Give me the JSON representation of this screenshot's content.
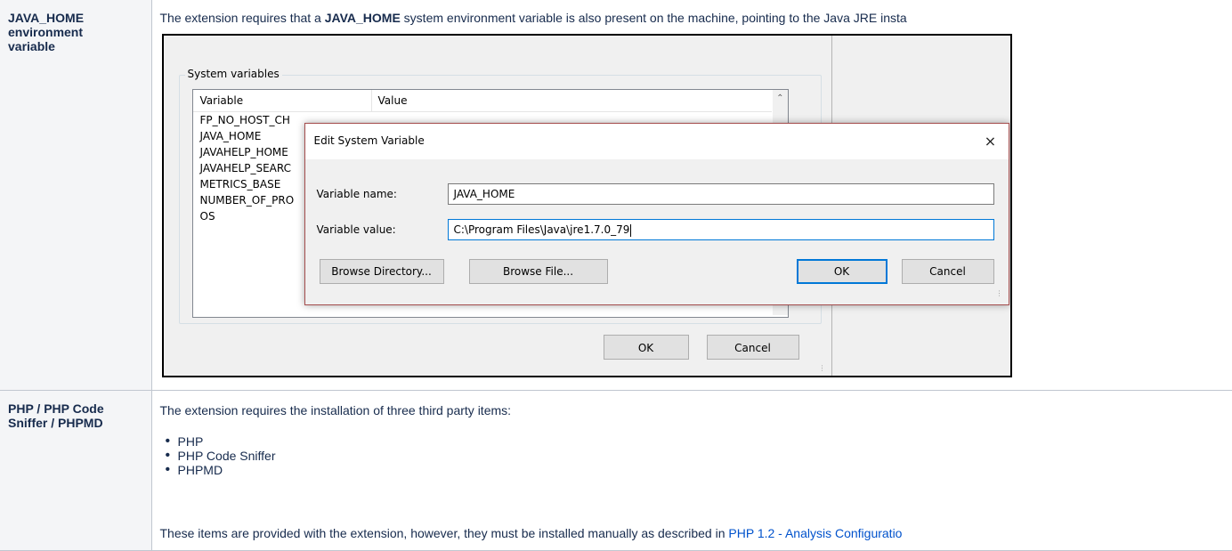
{
  "rows": [
    {
      "heading": "JAVA_HOME environment variable",
      "text_before": "The extension requires that a ",
      "text_bold": "JAVA_HOME",
      "text_after": " system environment variable is also present on the machine, pointing to the Java JRE insta"
    },
    {
      "heading": "PHP / PHP Code Sniffer / PHPMD",
      "intro": "The extension requires the installation of three third party items:",
      "items": [
        "PHP",
        "PHP Code Sniffer",
        "PHPMD"
      ],
      "footer_before": "These items are provided with the extension, however, they must be installed manually as described in ",
      "footer_link": "PHP 1.2 - Analysis Configuratio"
    }
  ],
  "screenshot": {
    "group_title": "System variables",
    "columns": [
      "Variable",
      "Value"
    ],
    "variables": [
      "FP_NO_HOST_CH",
      "JAVA_HOME",
      "JAVAHELP_HOME",
      "JAVAHELP_SEARC",
      "METRICS_BASE",
      "NUMBER_OF_PRO",
      "OS"
    ],
    "ok_label": "OK",
    "cancel_label": "Cancel",
    "dialog": {
      "title": "Edit System Variable",
      "close_glyph": "×",
      "name_label": "Variable name:",
      "name_value": "JAVA_HOME",
      "value_label": "Variable value:",
      "value_value": "C:\\Program Files\\Java\\jre1.7.0_79",
      "browse_dir_label": "Browse Directory...",
      "browse_file_label": "Browse File...",
      "ok_label": "OK",
      "cancel_label": "Cancel"
    }
  }
}
